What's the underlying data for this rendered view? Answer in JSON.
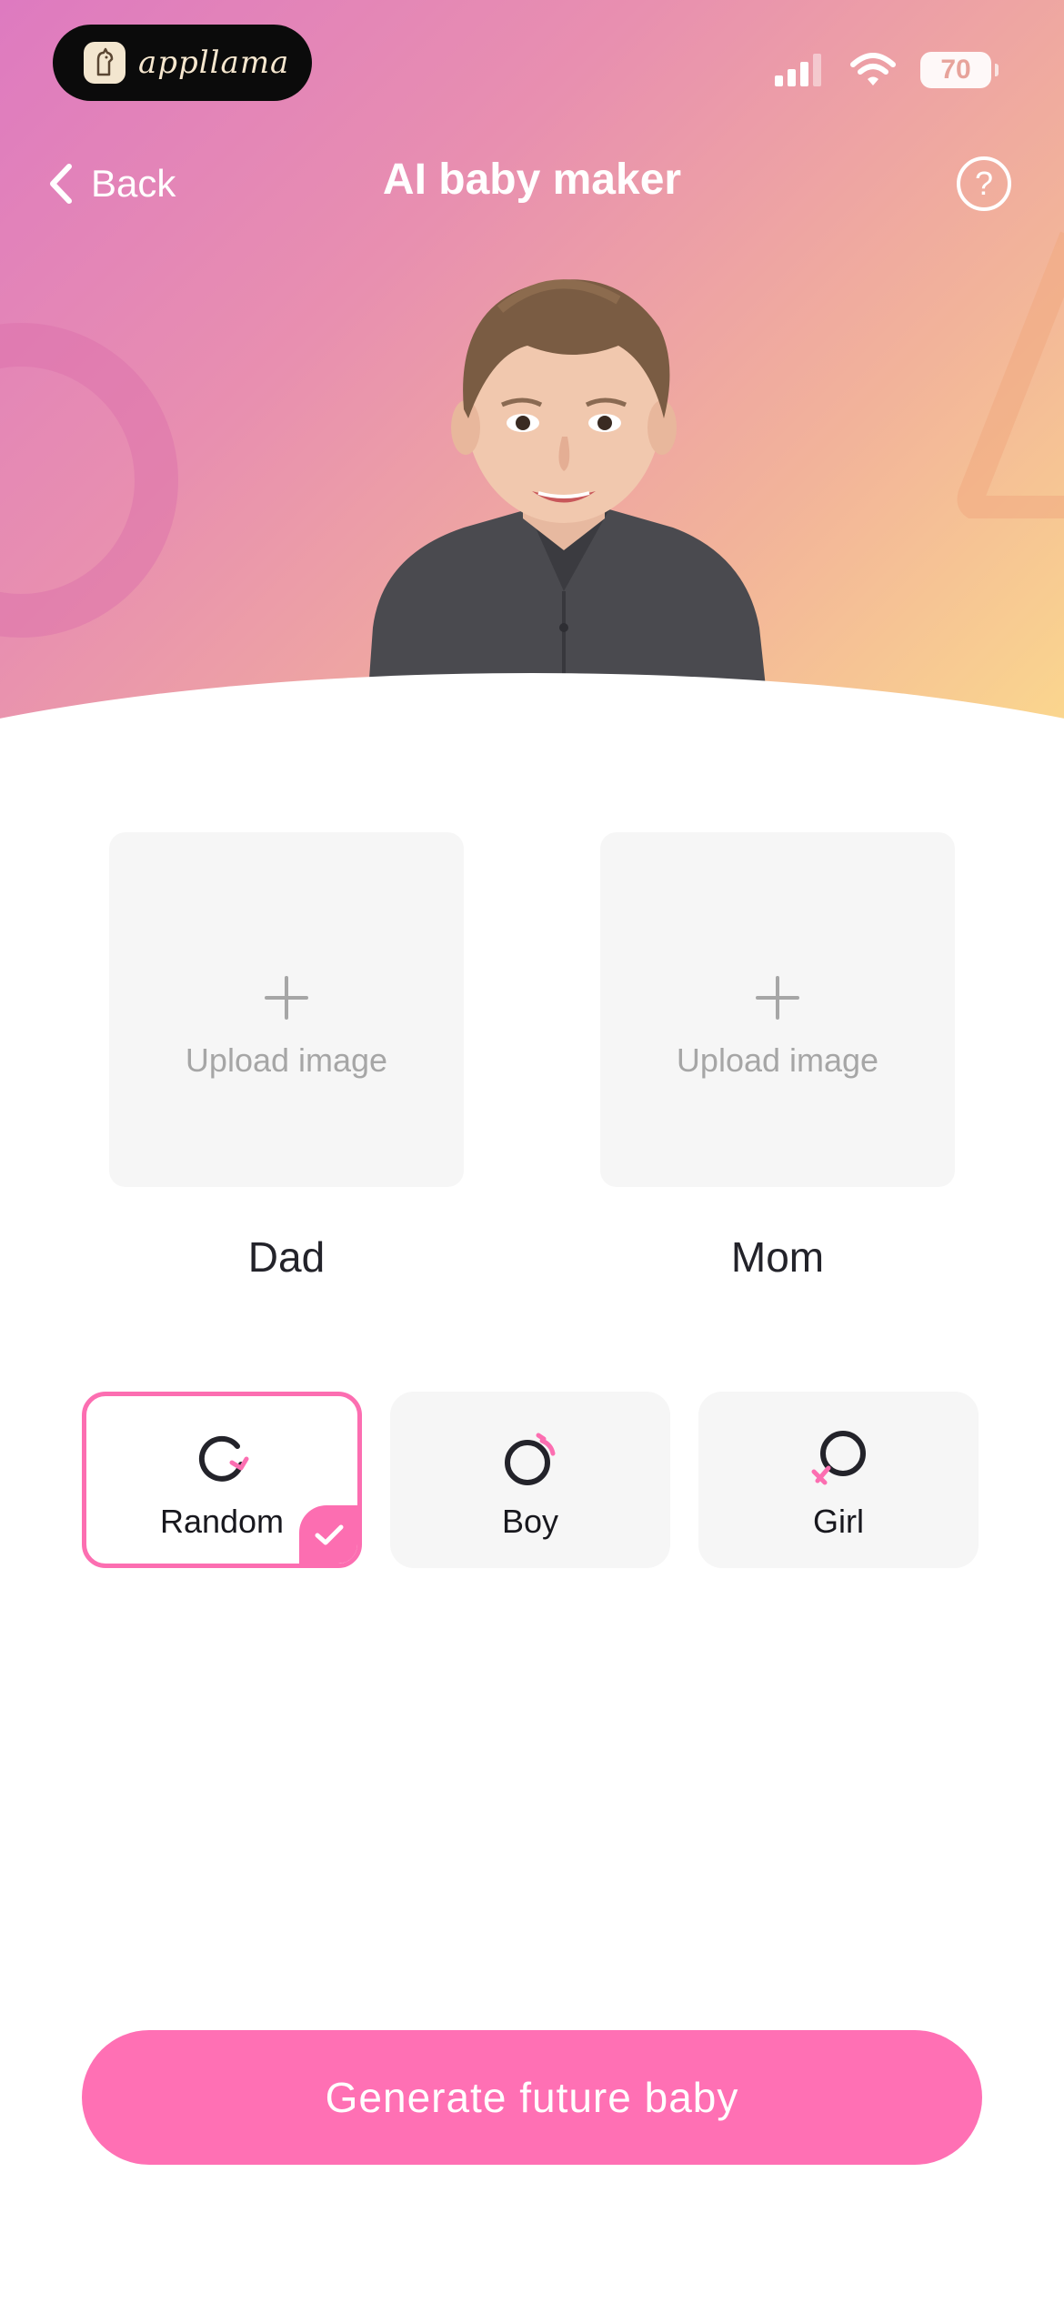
{
  "status_bar": {
    "app_badge": "appllama",
    "battery": "70"
  },
  "nav": {
    "back_label": "Back",
    "title": "AI baby maker",
    "help_glyph": "?"
  },
  "parents": [
    {
      "upload_label": "Upload image",
      "label": "Dad"
    },
    {
      "upload_label": "Upload image",
      "label": "Mom"
    }
  ],
  "gender_options": [
    {
      "label": "Random",
      "icon": "refresh-icon",
      "selected": true
    },
    {
      "label": "Boy",
      "icon": "male-icon",
      "selected": false
    },
    {
      "label": "Girl",
      "icon": "female-icon",
      "selected": false
    }
  ],
  "generate_button": {
    "label": "Generate future baby"
  },
  "colors": {
    "accent": "#ff70b4",
    "gradient_start": "#de7ac0",
    "gradient_end": "#fbd98d"
  }
}
